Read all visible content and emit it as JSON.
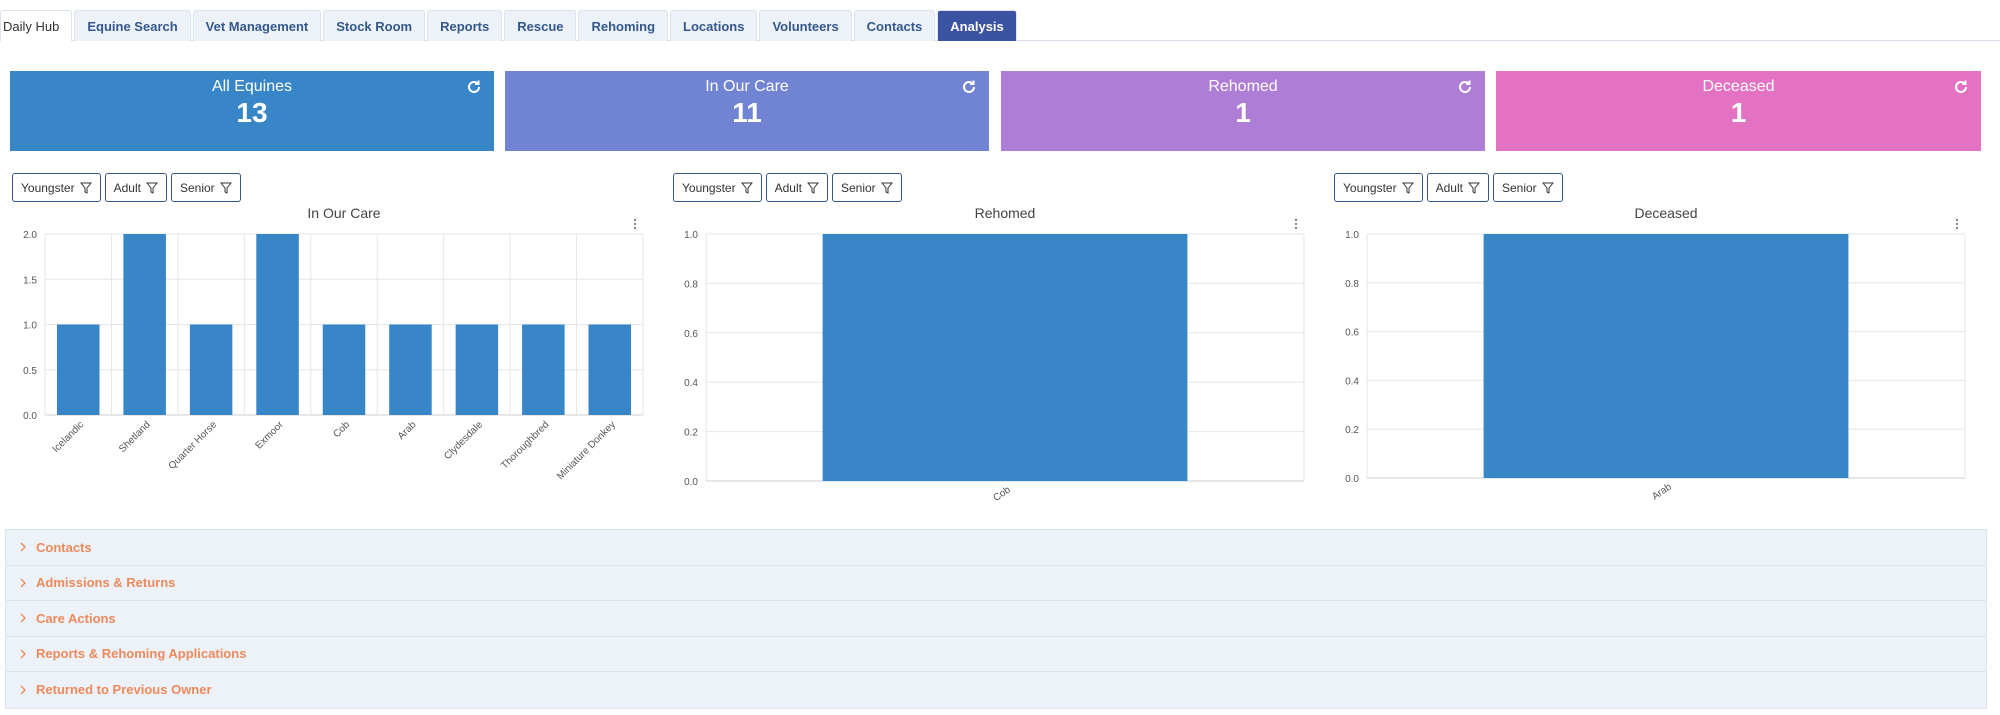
{
  "tabs": [
    "Daily Hub",
    "Equine Search",
    "Vet Management",
    "Stock Room",
    "Reports",
    "Rescue",
    "Rehoming",
    "Locations",
    "Volunteers",
    "Contacts",
    "Analysis"
  ],
  "active_tab": "Analysis",
  "stats": [
    {
      "title": "All Equines",
      "value": "13",
      "color": "#3886c8"
    },
    {
      "title": "In Our Care",
      "value": "11",
      "color": "#7184d4"
    },
    {
      "title": "Rehomed",
      "value": "1",
      "color": "#ae7dd5"
    },
    {
      "title": "Deceased",
      "value": "1",
      "color": "#e372c2"
    }
  ],
  "filters": [
    "Youngster",
    "Adult",
    "Senior"
  ],
  "chart_data": [
    {
      "type": "bar",
      "title": "In Our Care",
      "categories": [
        "Icelandic",
        "Shetland",
        "Quarter Horse",
        "Exmoor",
        "Cob",
        "Arab",
        "Clydesdale",
        "Thoroughbred",
        "Miniature Donkey"
      ],
      "values": [
        1,
        2,
        1,
        2,
        1,
        1,
        1,
        1,
        1
      ],
      "ylim": [
        0,
        2
      ],
      "yticks": [
        "0.0",
        "0.5",
        "1.0",
        "1.5",
        "2.0"
      ],
      "grid": true,
      "bar_color": "#3886c8"
    },
    {
      "type": "bar",
      "title": "Rehomed",
      "categories": [
        "Cob"
      ],
      "values": [
        1
      ],
      "ylim": [
        0,
        1
      ],
      "yticks": [
        "0.0",
        "0.2",
        "0.4",
        "0.6",
        "0.8",
        "1.0"
      ],
      "grid": true,
      "bar_color": "#3886c8"
    },
    {
      "type": "bar",
      "title": "Deceased",
      "categories": [
        "Arab"
      ],
      "values": [
        1
      ],
      "ylim": [
        0,
        1
      ],
      "yticks": [
        "0.0",
        "0.2",
        "0.4",
        "0.6",
        "0.8",
        "1.0"
      ],
      "grid": true,
      "bar_color": "#3886c8"
    }
  ],
  "accordion": [
    "Contacts",
    "Admissions & Returns",
    "Care Actions",
    "Reports & Rehoming Applications",
    "Returned to Previous Owner"
  ]
}
